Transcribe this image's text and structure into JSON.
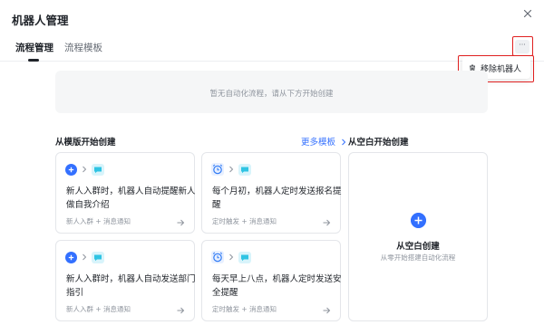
{
  "dialog": {
    "title": "机器人管理"
  },
  "tabs": [
    {
      "label": "流程管理",
      "active": true
    },
    {
      "label": "流程模板",
      "active": false
    }
  ],
  "more_button": {
    "label": "···"
  },
  "menu": {
    "items": [
      {
        "label": "移除机器人",
        "icon": "trash-icon"
      }
    ]
  },
  "empty_state": {
    "text": "暂无自动化流程，请从下方开始创建"
  },
  "templates_section": {
    "title": "从模版开始创建",
    "more_link": "更多模板",
    "cards": [
      {
        "desc": "新人入群时，机器人自动提醒新人做自我介绍",
        "meta": "新人入群 + 消息通知",
        "trigger_icon": "member-join-icon",
        "action_icon": "message-icon"
      },
      {
        "desc": "每个月初，机器人定时发送报名提醒",
        "meta": "定时触发 + 消息通知",
        "trigger_icon": "alarm-clock-icon",
        "action_icon": "message-icon"
      },
      {
        "desc": "新人入群时，机器人自动发送部门指引",
        "meta": "新人入群 + 消息通知",
        "trigger_icon": "member-join-icon",
        "action_icon": "message-icon"
      },
      {
        "desc": "每天早上八点，机器人定时发送安全提醒",
        "meta": "定时触发 + 消息通知",
        "trigger_icon": "alarm-clock-icon",
        "action_icon": "message-icon"
      }
    ]
  },
  "blank_section": {
    "title": "从空白开始创建",
    "card_title": "从空白创建",
    "card_subtitle": "从零开始搭建自动化流程"
  },
  "colors": {
    "accent": "#3370ff",
    "highlight_box": "#e02020",
    "clock_blue": "#2f7bf5",
    "message_cyan": "#2fc4e3"
  }
}
